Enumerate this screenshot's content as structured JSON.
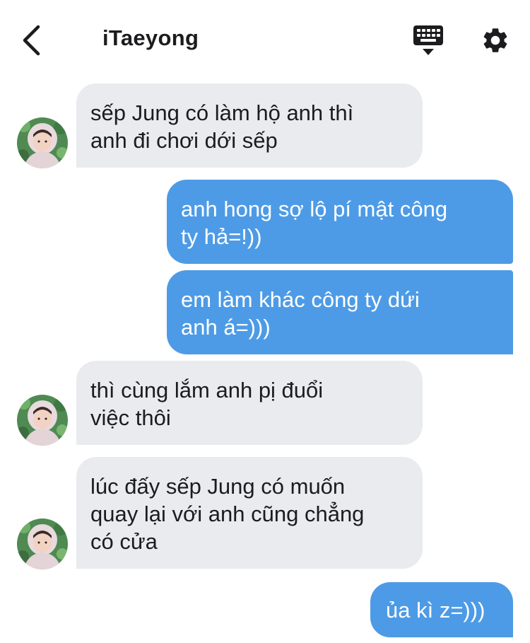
{
  "header": {
    "back_icon": "chevron-left-icon",
    "title": "iTaeyong",
    "keyboard_icon": "keyboard-icon",
    "settings_icon": "gear-icon"
  },
  "colors": {
    "incoming_bubble": "#e9ebef",
    "outgoing_bubble": "#4d9be6",
    "text_dark": "#1c1c1e"
  },
  "messages": [
    {
      "sender": "them",
      "text": "sếp Jung có làm hộ anh thì\nanh đi chơi dới sếp"
    },
    {
      "sender": "me",
      "text": "anh hong sợ lộ pí mật công\nty hả=!))"
    },
    {
      "sender": "me",
      "text": "em làm khác công ty dứi\nanh á=)))"
    },
    {
      "sender": "them",
      "text": "thì cùng lắm anh pị đuổi\nviệc thôi"
    },
    {
      "sender": "them",
      "text": "lúc đấy sếp Jung có muốn\nquay lại với anh cũng chẳng\ncó cửa"
    },
    {
      "sender": "me",
      "text": "ủa kì z=)))"
    }
  ]
}
